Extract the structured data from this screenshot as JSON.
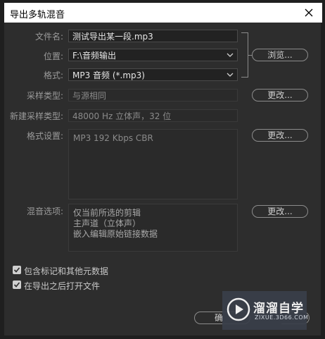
{
  "window": {
    "title": "导出多轨混音"
  },
  "form": {
    "filename": {
      "label": "文件名:",
      "value": "测试导出某一段.mp3"
    },
    "location": {
      "label": "位置:",
      "value": "F:\\音频输出"
    },
    "format": {
      "label": "格式:",
      "value": "MP3 音频 (*.mp3)"
    },
    "sample_type": {
      "label": "采样类型:",
      "value": "与源相同"
    },
    "new_sample_type": {
      "label": "新建采样类型:",
      "value": "48000 Hz 立体声，32 位"
    },
    "format_settings": {
      "label": "格式设置:",
      "value": "MP3 192 Kbps CBR"
    },
    "mix_options": {
      "label": "混音选项:",
      "lines": [
        "仅当前所选的剪辑",
        "主声道（立体声）",
        "嵌入编辑原始链接数据"
      ]
    }
  },
  "buttons": {
    "browse": "浏览...",
    "change_sample": "更改...",
    "change_format": "更改...",
    "change_mix": "更改...",
    "ok": "确"
  },
  "checkboxes": [
    {
      "label": "包含标记和其他元数据",
      "checked": true
    },
    {
      "label": "在导出之后打开文件",
      "checked": true
    }
  ],
  "watermark": {
    "title": "溜溜自学",
    "subtitle": "ZIXUE.3D66.COM"
  },
  "icons": {
    "close": "close-icon",
    "dropdown": "chevron-down-icon",
    "check": "check-icon",
    "logo": "play-logo-icon"
  }
}
